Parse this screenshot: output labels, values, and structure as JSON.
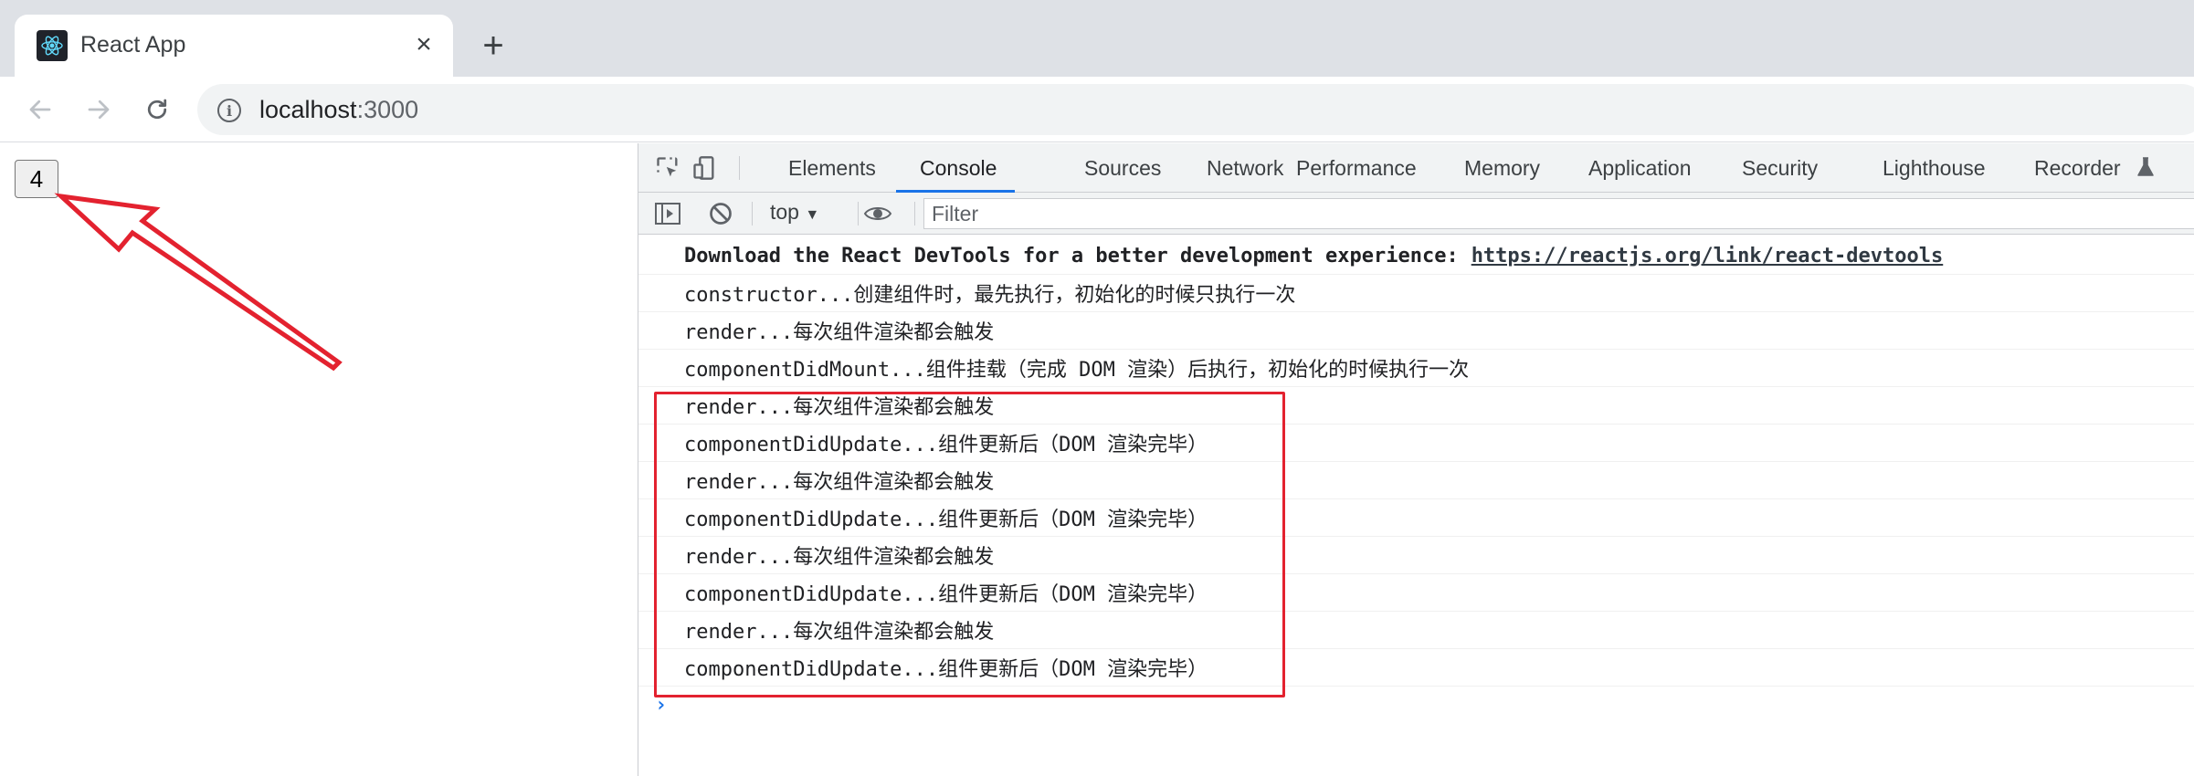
{
  "browser": {
    "tab": {
      "title": "React App",
      "close_glyph": "×",
      "favicon": "react-logo-icon"
    },
    "new_tab_glyph": "+",
    "address": {
      "host": "localhost",
      "port": ":3000"
    }
  },
  "page": {
    "counter_button_label": "4"
  },
  "devtools": {
    "tabs": [
      "Elements",
      "Console",
      "Sources",
      "Network",
      "Performance",
      "Memory",
      "Application",
      "Security",
      "Lighthouse",
      "Recorder"
    ],
    "active_tab": "Console",
    "context_select": "top",
    "filter_placeholder": "Filter",
    "console": {
      "devtools_message": "Download the React DevTools for a better development experience:",
      "devtools_link": "https://reactjs.org/link/react-devtools",
      "lines": [
        "constructor...创建组件时，最先执行，初始化的时候只执行一次",
        "render...每次组件渲染都会触发",
        "componentDidMount...组件挂载（完成 DOM 渲染）后执行，初始化的时候执行一次",
        "render...每次组件渲染都会触发",
        "componentDidUpdate...组件更新后（DOM 渲染完毕）",
        "render...每次组件渲染都会触发",
        "componentDidUpdate...组件更新后（DOM 渲染完毕）",
        "render...每次组件渲染都会触发",
        "componentDidUpdate...组件更新后（DOM 渲染完毕）",
        "render...每次组件渲染都会触发",
        "componentDidUpdate...组件更新后（DOM 渲染完毕）"
      ],
      "prompt_glyph": "›"
    }
  },
  "annotations": {
    "highlight_color": "#e3222f"
  }
}
